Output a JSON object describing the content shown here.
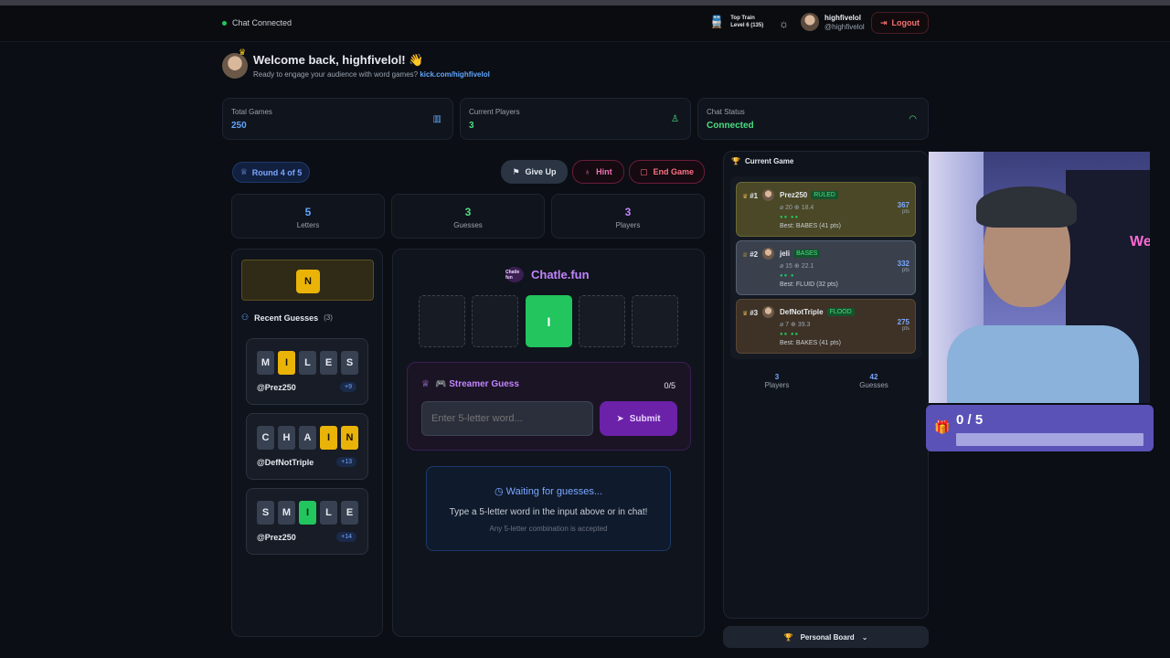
{
  "topbar": {
    "status": "Chat Connected",
    "train_title": "Top Train",
    "train_level": "Level 6 (135)",
    "username": "highfivelol",
    "handle": "@highfivelol",
    "logout": "Logout"
  },
  "welcome": {
    "title": "Welcome back, highfivelol! 👋",
    "subtitle": "Ready to engage your audience with word games?",
    "link": "kick.com/highfivelol"
  },
  "stats": [
    {
      "label": "Total Games",
      "value": "250",
      "color": "#60a5fa",
      "icon": "chart-icon"
    },
    {
      "label": "Current Players",
      "value": "3",
      "color": "#4ade80",
      "icon": "user-icon"
    },
    {
      "label": "Chat Status",
      "value": "Connected",
      "color": "#4ade80",
      "icon": "wifi-icon"
    }
  ],
  "game": {
    "round": "Round 4 of 5",
    "give_up": "Give Up",
    "hint": "Hint",
    "end_game": "End Game"
  },
  "mini": [
    {
      "value": "5",
      "label": "Letters",
      "color": "#60a5fa"
    },
    {
      "value": "3",
      "label": "Guesses",
      "color": "#4ade80"
    },
    {
      "value": "3",
      "label": "Players",
      "color": "#c084fc"
    }
  ],
  "hint_letter": "N",
  "recent": {
    "title": "Recent Guesses",
    "count": "(3)",
    "items": [
      {
        "letters": [
          "M",
          "I",
          "L",
          "E",
          "S"
        ],
        "states": [
          "n",
          "y",
          "n",
          "n",
          "n"
        ],
        "user": "@Prez250",
        "pts": "+9"
      },
      {
        "letters": [
          "C",
          "H",
          "A",
          "I",
          "N"
        ],
        "states": [
          "n",
          "n",
          "n",
          "y",
          "y"
        ],
        "user": "@DefNotTriple",
        "pts": "+13"
      },
      {
        "letters": [
          "S",
          "M",
          "I",
          "L",
          "E"
        ],
        "states": [
          "n",
          "n",
          "g",
          "n",
          "n"
        ],
        "user": "@Prez250",
        "pts": "+14"
      }
    ]
  },
  "brand": {
    "name": "Chatle.fun",
    "logo": "Chatle fun"
  },
  "board": [
    "",
    "",
    "I",
    "",
    ""
  ],
  "streamer": {
    "title": "🎮 Streamer Guess",
    "count": "0/5",
    "placeholder": "Enter 5-letter word...",
    "submit": "Submit"
  },
  "waiting": {
    "title": "Waiting for guesses...",
    "line1": "Type a 5-letter word in the input above or in chat!",
    "line2": "Any 5-letter combination is accepted"
  },
  "current": {
    "title": "Current Game",
    "players": [
      {
        "rank": "#1",
        "name": "Prez250",
        "tag": "RULED",
        "stats": "⌀ 20 ⊕ 18.4",
        "dots": "●● ●●",
        "best": "Best: BABES (41 pts)",
        "score": "367",
        "unit": "pts",
        "bg": "#4a4826",
        "border": "#6b6a34"
      },
      {
        "rank": "#2",
        "name": "jeli",
        "tag": "BASES",
        "stats": "⌀ 15 ⊕ 22.1",
        "dots": "●● ●",
        "best": "Best: FLUID (32 pts)",
        "score": "332",
        "unit": "pts",
        "bg": "#3a414c",
        "border": "#566070"
      },
      {
        "rank": "#3",
        "name": "DefNotTriple",
        "tag": "FLOOD",
        "stats": "⌀ 7 ⊕ 39.3",
        "dots": "●● ●●",
        "best": "Best: BAKES (41 pts)",
        "score": "275",
        "unit": "pts",
        "bg": "#3e3226",
        "border": "#5a4634"
      }
    ],
    "players_count": "3",
    "players_label": "Players",
    "guesses_count": "42",
    "guesses_label": "Guesses"
  },
  "personal_board": "Personal Board",
  "overlay": {
    "progress_text": "0 / 5",
    "progress_value": 0,
    "neon": "We"
  }
}
